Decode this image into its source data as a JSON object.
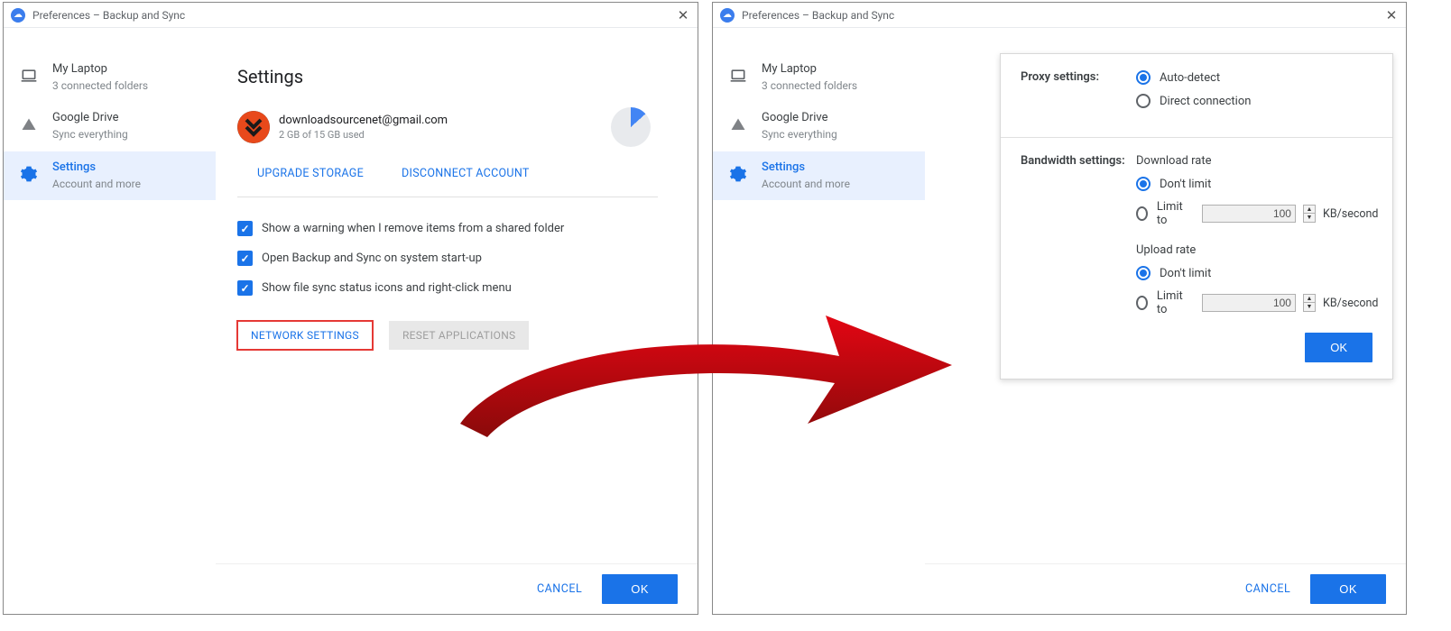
{
  "windowTitle": "Preferences – Backup and Sync",
  "sidebar": {
    "items": [
      {
        "title": "My Laptop",
        "sub": "3 connected folders"
      },
      {
        "title": "Google Drive",
        "sub": "Sync everything"
      },
      {
        "title": "Settings",
        "sub": "Account and more"
      }
    ]
  },
  "settings": {
    "heading": "Settings",
    "email": "downloadsourcenet@gmail.com",
    "storage": "2 GB of 15 GB used",
    "upgrade": "UPGRADE STORAGE",
    "disconnect": "DISCONNECT ACCOUNT",
    "checks": {
      "warn": "Show a warning when I remove items from a shared folder",
      "startup": "Open Backup and Sync on system start-up",
      "icons": "Show file sync status icons and right-click menu"
    },
    "network": "NETWORK SETTINGS",
    "reset": "RESET APPLICATIONS"
  },
  "dialog": {
    "proxyLabel": "Proxy settings:",
    "proxy": {
      "auto": "Auto-detect",
      "direct": "Direct connection"
    },
    "bandwidthLabel": "Bandwidth settings:",
    "download": {
      "head": "Download rate",
      "dont": "Don't limit",
      "limit": "Limit to",
      "value": "100",
      "unit": "KB/second"
    },
    "upload": {
      "head": "Upload rate",
      "dont": "Don't limit",
      "limit": "Limit to",
      "value": "100",
      "unit": "KB/second"
    },
    "ok": "OK"
  },
  "footer": {
    "cancel": "CANCEL",
    "ok": "OK"
  }
}
